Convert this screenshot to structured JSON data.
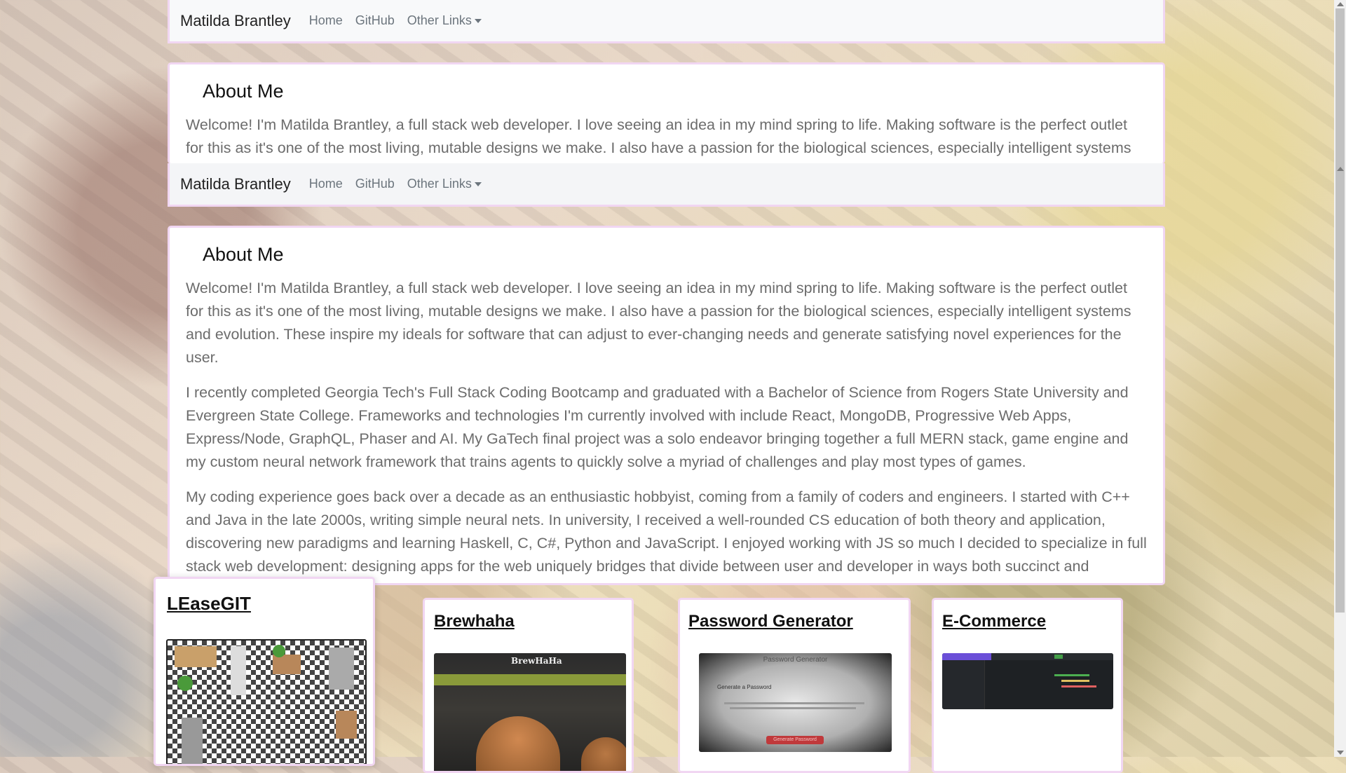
{
  "nav": {
    "brand": "Matilda Brantley",
    "links": [
      "Home",
      "GitHub",
      "Other Links"
    ]
  },
  "about": {
    "heading": "About Me",
    "paragraphs": [
      "Welcome! I'm Matilda Brantley, a full stack web developer. I love seeing an idea in my mind spring to life. Making software is the perfect outlet for this as it's one of the most living, mutable designs we make. I also have a passion for the biological sciences, especially intelligent systems and evolution. These inspire my ideals for software that can adjust to ever-changing needs and generate satisfying novel experiences for the user.",
      "I recently completed Georgia Tech's Full Stack Coding Bootcamp and graduated with a Bachelor of Science from Rogers State University and Evergreen State College. Frameworks and technologies I'm currently involved with include React, MongoDB, Progressive Web Apps, Express/Node, GraphQL, Phaser and AI. My GaTech final project was a solo endeavor bringing together a full MERN stack, game engine and my custom neural network framework that trains agents to quickly solve a myriad of challenges and play most types of games.",
      "My coding experience goes back over a decade as an enthusiastic hobbyist, coming from a family of coders and engineers. I started with C++ and Java in the late 2000s, writing simple neural nets. In university, I received a well-rounded CS education of both theory and application, discovering new paradigms and learning Haskell, C, C#, Python and JavaScript. I enjoyed working with JS so much I decided to specialize in full stack web development: designing apps for the web uniquely bridges that divide between user and developer in ways both succinct and satisfying."
    ],
    "ghost_text": "Welcome! I'm Matilda Brantley, a full stack web developer. I love seeing an idea in my mind spring to life. Making software is the perfect outlet for this as it's one of the most living, mutable designs we make. I also have a passion for the biological sciences, especially intelligent systems and evolution."
  },
  "projects": [
    {
      "title": "LEaseGIT",
      "thumb": "game-map"
    },
    {
      "title": "Brewhaha",
      "thumb": "brewery"
    },
    {
      "title": "Password Generator",
      "thumb": "password-app",
      "thumb_title": "Password Generator",
      "thumb_sub": "Generate a Password",
      "thumb_button": "Generate Password"
    },
    {
      "title": "E-Commerce",
      "thumb": "code-editor"
    }
  ],
  "brewhaha_thumb_text": "BrewHaHa",
  "colors": {
    "card_border": "#f1d6f2",
    "nav_bg": "#f8f9fa",
    "text": "#6c6c6c"
  }
}
